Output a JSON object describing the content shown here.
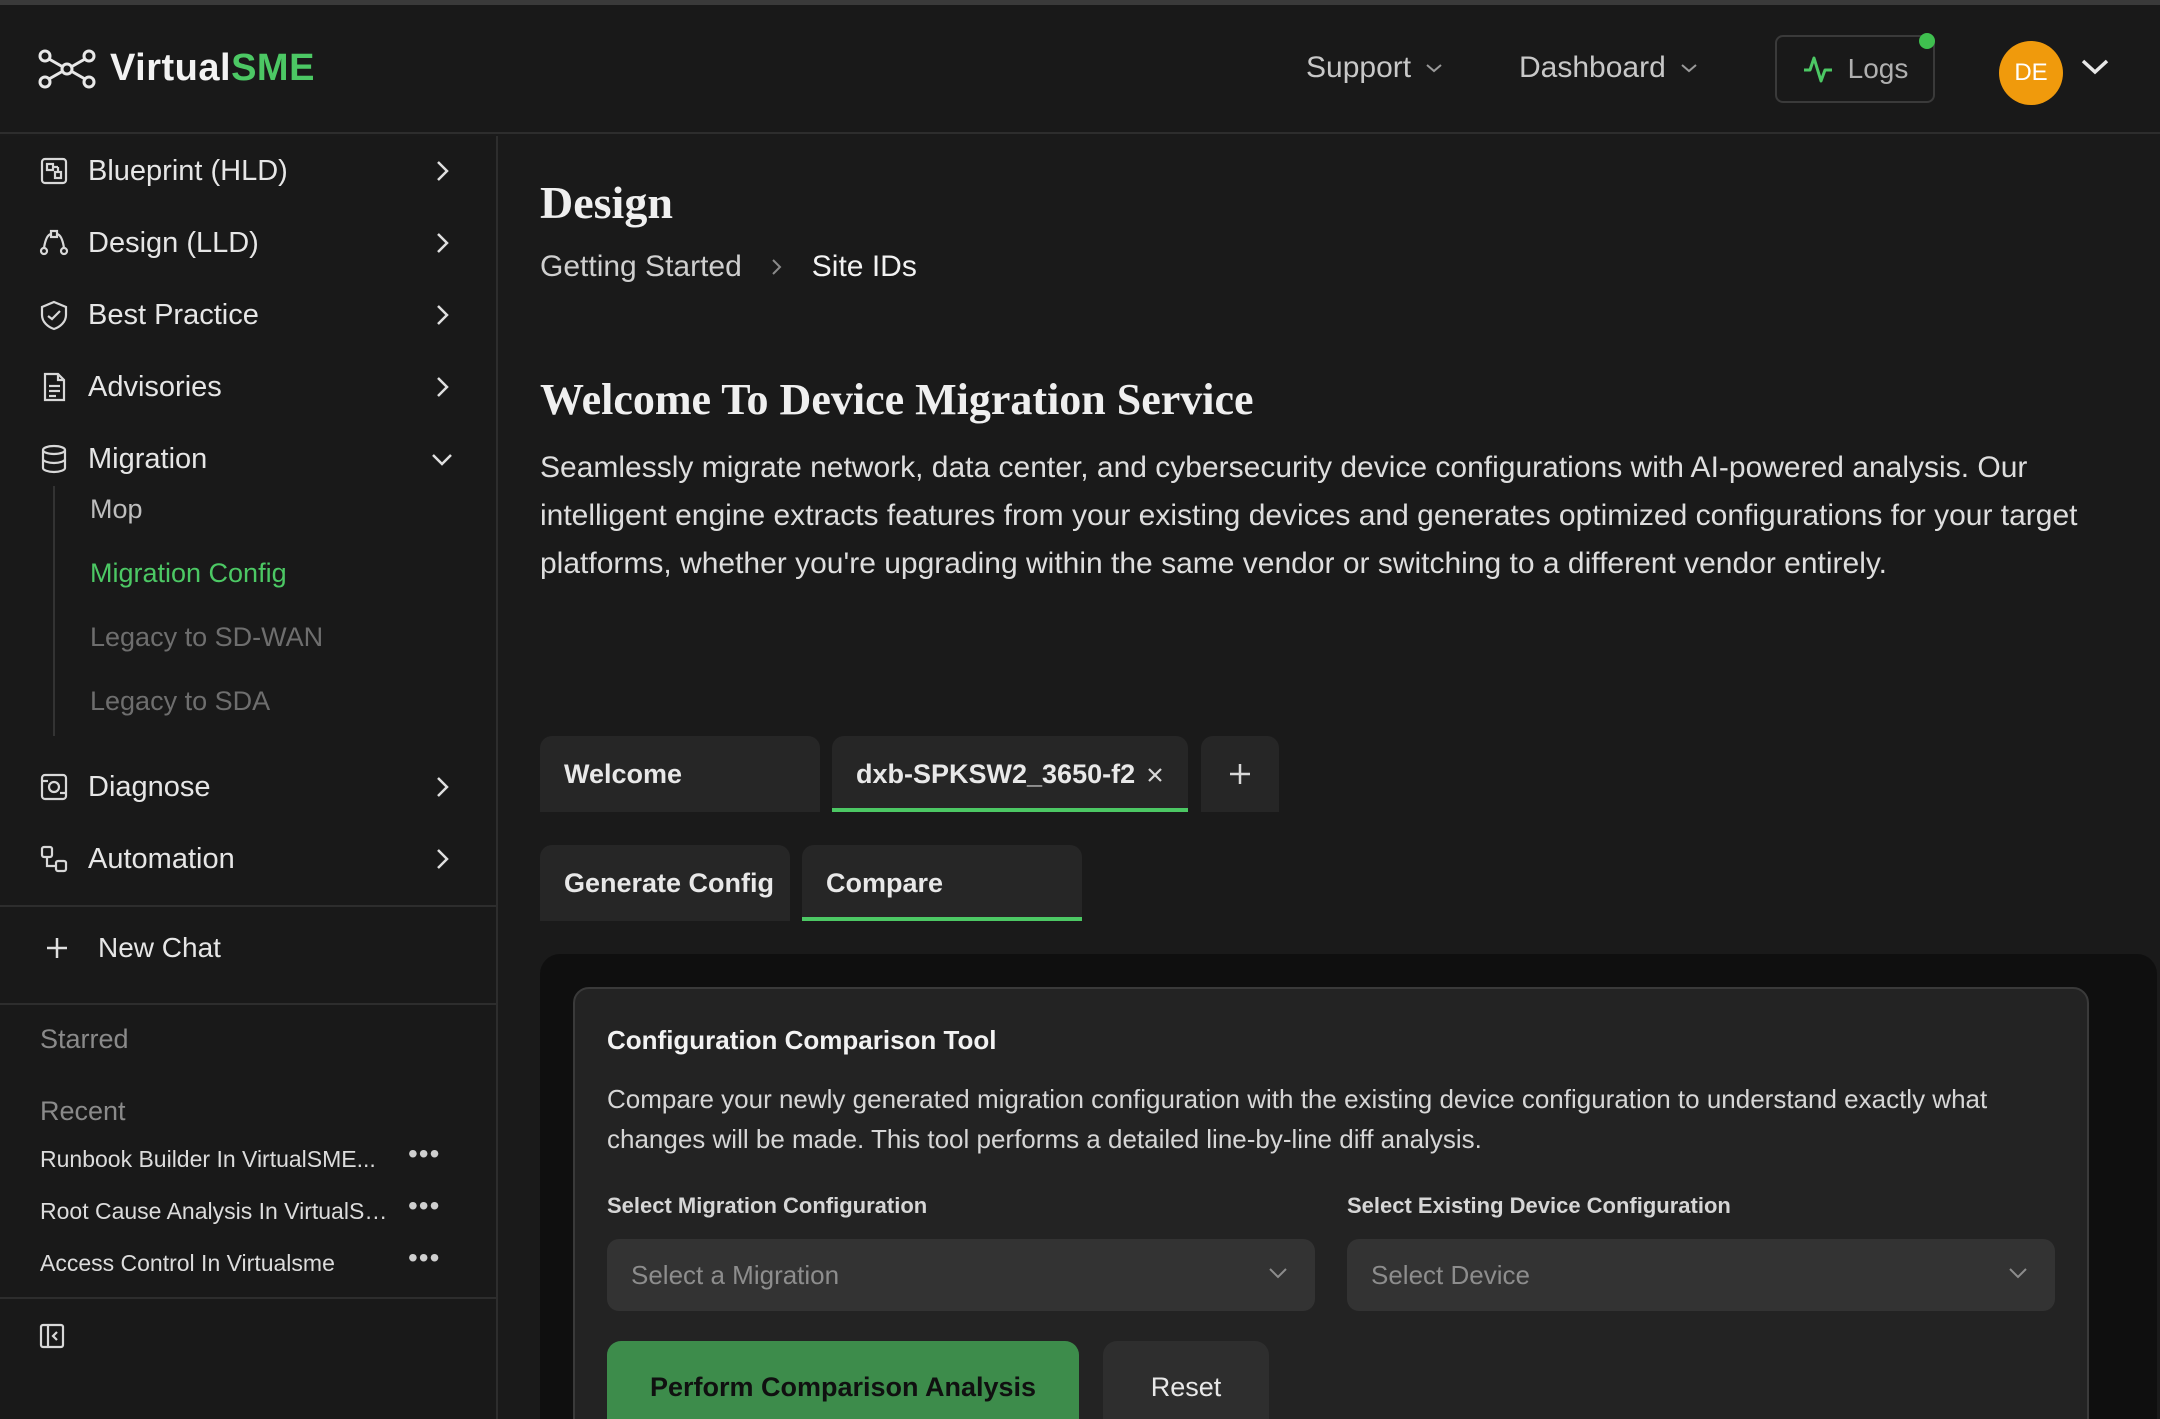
{
  "header": {
    "logo_prefix": "Virtual",
    "logo_suffix": "SME",
    "support_label": "Support",
    "dashboard_label": "Dashboard",
    "logs_label": "Logs",
    "avatar_initials": "DE",
    "accent_color": "#4cc864",
    "avatar_color": "#f09a0c"
  },
  "sidebar": {
    "items": [
      {
        "label": "Blueprint (HLD)",
        "icon": "blueprint-icon"
      },
      {
        "label": "Design (LLD)",
        "icon": "design-icon"
      },
      {
        "label": "Best Practice",
        "icon": "shield-icon"
      },
      {
        "label": "Advisories",
        "icon": "document-icon"
      },
      {
        "label": "Migration",
        "icon": "database-icon"
      },
      {
        "label": "Diagnose",
        "icon": "diagnose-icon"
      },
      {
        "label": "Automation",
        "icon": "automation-icon"
      }
    ],
    "migration_sub": [
      "Mop",
      "Migration Config",
      "Legacy to SD-WAN",
      "Legacy to SDA"
    ],
    "new_chat_label": "New Chat",
    "starred_label": "Starred",
    "recent_label": "Recent",
    "recent_items": [
      "Runbook Builder In VirtualSME...",
      "Root Cause Analysis In VirtualSME",
      "Access Control In Virtualsme"
    ]
  },
  "main": {
    "page_title": "Design",
    "breadcrumb": [
      "Getting Started",
      "Site IDs"
    ],
    "welcome_title": "Welcome To Device Migration Service",
    "welcome_desc": "Seamlessly migrate network, data center, and cybersecurity device configurations with AI-powered analysis. Our intelligent engine extracts features from your existing devices and generates optimized configurations for your target platforms, whether you're upgrading within the same vendor or switching to a different vendor entirely.",
    "tabs": [
      {
        "label": "Welcome"
      },
      {
        "label": "dxb-SPKSW2_3650-f2"
      }
    ],
    "subtabs": [
      {
        "label": "Generate Config"
      },
      {
        "label": "Compare"
      }
    ],
    "panel": {
      "title": "Configuration Comparison Tool",
      "desc": "Compare your newly generated migration configuration with the existing device configuration to understand exactly what changes will be made. This tool performs a detailed line-by-line diff analysis.",
      "migration_label": "Select Migration Configuration",
      "migration_placeholder": "Select a Migration",
      "device_label": "Select Existing Device Configuration",
      "device_placeholder": "Select Device",
      "perform_label": "Perform Comparison Analysis",
      "reset_label": "Reset"
    }
  }
}
